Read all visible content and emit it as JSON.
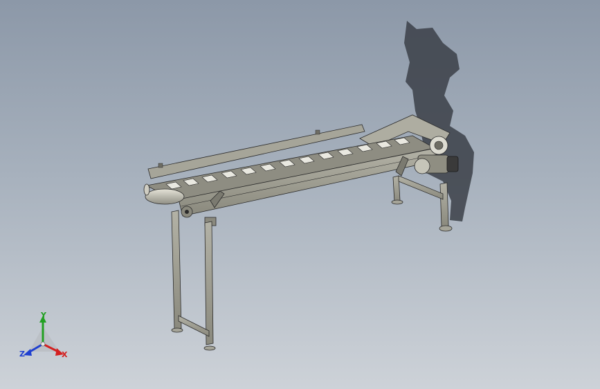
{
  "viewport": {
    "background_top": "#8c98a8",
    "background_bottom": "#cdd2d8"
  },
  "model": {
    "name": "inclined-belt-conveyor",
    "frame_color": "#9b9a8e",
    "edge_color": "#2a2a2a",
    "shadow_color": "#3a3f46"
  },
  "triad": {
    "x_label": "X",
    "y_label": "Y",
    "z_label": "Z",
    "x_color": "#d32020",
    "y_color": "#22a022",
    "z_color": "#2040d0"
  }
}
